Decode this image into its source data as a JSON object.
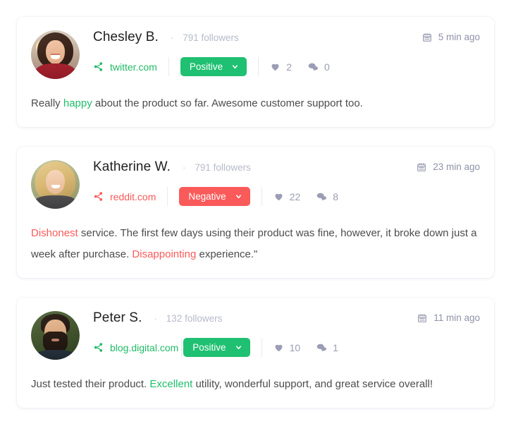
{
  "theme": {
    "positive_color": "#1fc071",
    "negative_color": "#fb5a5a",
    "positive_link_color": "#22bb68",
    "muted_text_color": "#b7bacb",
    "body_text_color": "#4c4c4c",
    "card_background": "#ffffff"
  },
  "posts": [
    {
      "author": "Chesley B.",
      "separator": "·",
      "followers": "791 followers",
      "source": "twitter.com",
      "sentiment": "Positive",
      "sentiment_type": "positive",
      "likes": "2",
      "comments": "0",
      "time": "5 min ago",
      "avatar_alt": "chesley-b-avatar",
      "body": [
        {
          "text": "Really ",
          "highlight": "none"
        },
        {
          "text": "happy",
          "highlight": "positive"
        },
        {
          "text": " about the product so far. Awesome customer support too.",
          "highlight": "none"
        }
      ]
    },
    {
      "author": "Katherine W.",
      "separator": "·",
      "followers": "791 followers",
      "source": "reddit.com",
      "sentiment": "Negative",
      "sentiment_type": "negative",
      "likes": "22",
      "comments": "8",
      "time": "23 min ago",
      "avatar_alt": "katherine-w-avatar",
      "body": [
        {
          "text": "Dishonest",
          "highlight": "negative"
        },
        {
          "text": " service. The first few days using their product was fine, however, it broke down just a week after purchase. ",
          "highlight": "none"
        },
        {
          "text": "Disappointing",
          "highlight": "negative"
        },
        {
          "text": " experience.\"",
          "highlight": "none"
        }
      ]
    },
    {
      "author": "Peter S.",
      "separator": "·",
      "followers": "132 followers",
      "source": "blog.digital.com",
      "sentiment": "Positive",
      "sentiment_type": "positive",
      "likes": "10",
      "comments": "1",
      "time": "11 min ago",
      "avatar_alt": "peter-s-avatar",
      "body": [
        {
          "text": "Just tested their product. ",
          "highlight": "none"
        },
        {
          "text": "Excellent",
          "highlight": "positive"
        },
        {
          "text": " utility, wonderful support, and great service overall!",
          "highlight": "none"
        }
      ]
    }
  ],
  "icons": {
    "share": "share-icon",
    "like": "heart-icon",
    "comment": "comment-icon",
    "calendar": "calendar-icon",
    "chevron": "chevron-down-icon"
  }
}
